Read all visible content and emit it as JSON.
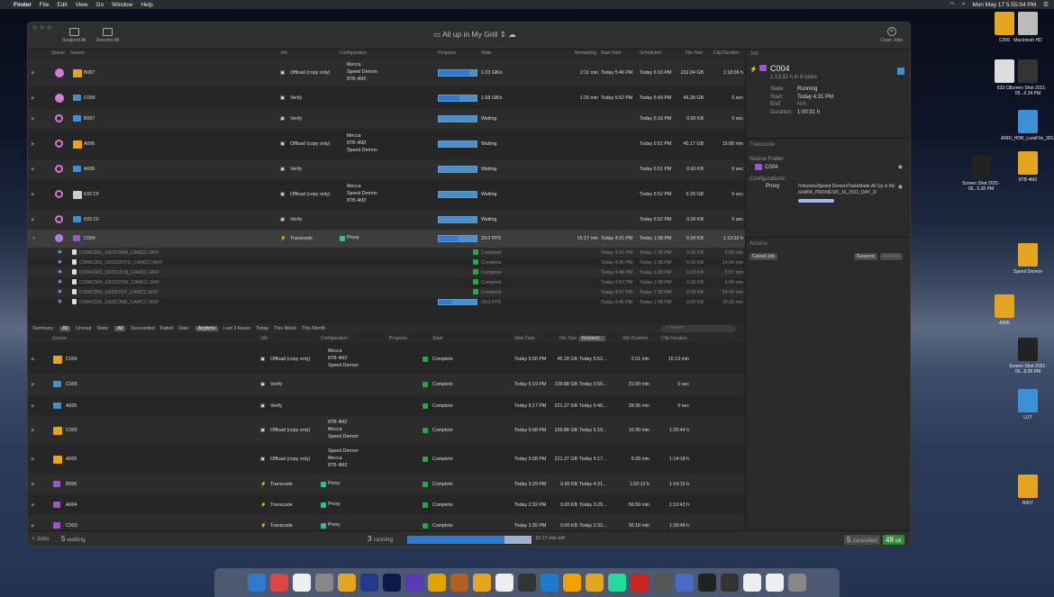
{
  "menubar": {
    "apple": "",
    "app": "Finder",
    "items": [
      "File",
      "Edit",
      "View",
      "Go",
      "Window",
      "Help"
    ],
    "clock": "Mon May 17  5:55:54 PM"
  },
  "window": {
    "title": "All up in My Grill ⇕",
    "suspend_all": "Suspend All",
    "resume_all": "Resume All",
    "close_jobs": "Close Jobs"
  },
  "queue_headers": {
    "queue": "Queue",
    "source": "Source",
    "job": "Job",
    "configuration": "Configuration",
    "progress": "Progress",
    "state": "State",
    "remaining": "Remaining",
    "start_date": "Start Date",
    "scheduled": "Scheduled",
    "file_size": "File Size",
    "clip_duration": "Clip Duration"
  },
  "queue_rows": [
    {
      "source": "B007",
      "job": "Offload (copy only)",
      "config": [
        "Mecca",
        "Speed Demon",
        "8TB 4M2"
      ],
      "progress": 0.82,
      "state": "1.03 GB/s",
      "remaining": "2:11 min",
      "start": "Today 5:46 PM",
      "scheduled": "Today 5:16 PM",
      "size": "232.04 GB",
      "dur": "1:18:06 h"
    },
    {
      "source": "C006",
      "job": "Verify",
      "config": [],
      "progress": 0.55,
      "state": "1.68 GB/s",
      "remaining": "1:25 min",
      "start": "Today 5:52 PM",
      "scheduled": "Today 5:49 PM",
      "size": "45.28 GB",
      "dur": "0 sec"
    },
    {
      "source": "B007",
      "job": "Verify",
      "config": [],
      "progress": 0,
      "state": "Waiting",
      "remaining": "",
      "start": "",
      "scheduled": "Today 5:16 PM",
      "size": "0.00 KB",
      "dur": "0 sec"
    },
    {
      "source": "A006",
      "job": "Offload (copy only)",
      "config": [
        "Mecca",
        "8TB 4M2",
        "Speed Demon"
      ],
      "progress": 0,
      "state": "Waiting",
      "remaining": "",
      "start": "",
      "scheduled": "Today 5:51 PM",
      "size": "45.17 GB",
      "dur": "15:08 min"
    },
    {
      "source": "A006",
      "job": "Verify",
      "config": [],
      "progress": 0,
      "state": "Waiting",
      "remaining": "",
      "start": "",
      "scheduled": "Today 5:51 PM",
      "size": "0.00 KB",
      "dur": "0 sec"
    },
    {
      "source": "633 CF",
      "job": "Offload (copy only)",
      "config": [
        "Mecca",
        "Speed Demon",
        "8TB 4M2"
      ],
      "progress": 0,
      "state": "Waiting",
      "remaining": "",
      "start": "",
      "scheduled": "Today 5:52 PM",
      "size": "6.29 GB",
      "dur": "0 sec"
    },
    {
      "source": "633 CF",
      "job": "Verify",
      "config": [],
      "progress": 0,
      "state": "Waiting",
      "remaining": "",
      "start": "",
      "scheduled": "Today 5:52 PM",
      "size": "0.00 KB",
      "dur": "0 sec"
    },
    {
      "source": "C004",
      "job": "Transcode",
      "config": [
        "Proxy"
      ],
      "progress": 0.5,
      "state": "29.0 FPS",
      "remaining": "15:17 min",
      "start": "Today 4:31 PM",
      "scheduled": "Today 1:38 PM",
      "size": "0.00 KB",
      "dur": "1:13:32 h"
    }
  ],
  "sub_rows": [
    {
      "name": "C004C001_160313BM_CAMCC.MXF",
      "state": "Complete",
      "start": "Today 4:31 PM",
      "sched": "Today 1:38 PM",
      "size": "0.00 KB",
      "dur": "6:00 min"
    },
    {
      "name": "C004C002_160313OYO_CAMCC.MXF",
      "state": "Complete",
      "start": "Today 4:36 PM",
      "sched": "Today 1:38 PM",
      "size": "0.00 KB",
      "dur": "14:34 min"
    },
    {
      "name": "C004C003_160313CM_CAMCC.MXF",
      "state": "Complete",
      "start": "Today 4:48 PM",
      "sched": "Today 1:38 PM",
      "size": "0.00 KB",
      "dur": "5:57 min"
    },
    {
      "name": "C004C004_160313SW_CAMCC.MXF",
      "state": "Complete",
      "start": "Today 4:52 PM",
      "sched": "Today 1:38 PM",
      "size": "0.00 KB",
      "dur": "5:43 min"
    },
    {
      "name": "C004C005_160313SY_CAMCC.MXF",
      "state": "Complete",
      "start": "Today 4:57 PM",
      "sched": "Today 1:38 PM",
      "size": "0.00 KB",
      "dur": "24:43 min"
    },
    {
      "name": "C004C006_160313NR_CAMCC.MXF",
      "state": "29.0 FPS",
      "start": "Today 5:46 PM",
      "sched": "Today 1:38 PM",
      "size": "0.00 KB",
      "dur": "16:32 min"
    }
  ],
  "summary": {
    "label": "Summary:",
    "all": "All",
    "unread": "Unread",
    "state_label": "State:",
    "state_all": "All",
    "succeeded": "Succeeded",
    "failed": "Failed",
    "date_label": "Date:",
    "anytime": "Anytime",
    "last2": "Last 2 Hours",
    "today": "Today",
    "week": "This Week",
    "month": "This Month",
    "search_placeholder": "Search"
  },
  "history_headers": {
    "source": "Source",
    "job": "Job",
    "configuration": "Configuration",
    "progress": "Progress",
    "state": "State",
    "start_date": "Start Date",
    "file_size": "File Size",
    "finished": "Finished...",
    "job_duration": "Job Duration",
    "clip_duration": "Clip Duration"
  },
  "history_rows": [
    {
      "source": "C006",
      "job": "Offload (copy only)",
      "config": [
        "Mecca",
        "8TB 4M2",
        "Speed Demon"
      ],
      "state": "Complete",
      "start": "Today 5:50 PM",
      "size": "45.28 GB",
      "fin": "Today 5:52...",
      "jdur": "2:01 min",
      "cdur": "15:13 min"
    },
    {
      "source": "C005",
      "job": "Verify",
      "config": [],
      "state": "Complete",
      "start": "Today 5:19 PM",
      "size": "239.88 GB",
      "fin": "Today 5:50...",
      "jdur": "31:00 min",
      "cdur": "0 sec"
    },
    {
      "source": "A005",
      "job": "Verify",
      "config": [],
      "state": "Complete",
      "start": "Today 5:17 PM",
      "size": "221.37 GB",
      "fin": "Today 5:46...",
      "jdur": "28:36 min",
      "cdur": "0 sec"
    },
    {
      "source": "C005",
      "job": "Offload (copy only)",
      "config": [
        "8TB 4M2",
        "Mecca",
        "Speed Demon"
      ],
      "state": "Complete",
      "start": "Today 5:08 PM",
      "size": "239.88 GB",
      "fin": "Today 5:19...",
      "jdur": "10:30 min",
      "cdur": "1:20:44 h"
    },
    {
      "source": "A005",
      "job": "Offload (copy only)",
      "config": [
        "Speed Demon",
        "Mecca",
        "8TB 4M2"
      ],
      "state": "Complete",
      "start": "Today 5:08 PM",
      "size": "221.37 GB",
      "fin": "Today 5:17...",
      "jdur": "9:28 min",
      "cdur": "1:14:18 h"
    },
    {
      "source": "B006",
      "job": "Transcode",
      "config": [
        "Proxy"
      ],
      "state": "Complete",
      "start": "Today 3:29 PM",
      "size": "0.00 KB",
      "fin": "Today 4:31...",
      "jdur": "1:02:12 h",
      "cdur": "1:14:15 h"
    },
    {
      "source": "A004",
      "job": "Transcode",
      "config": [
        "Proxy"
      ],
      "state": "Complete",
      "start": "Today 2:32 PM",
      "size": "0.00 KB",
      "fin": "Today 3:29...",
      "jdur": "56:59 min",
      "cdur": "1:13:42 h"
    },
    {
      "source": "C003",
      "job": "Transcode",
      "config": [
        "Proxy"
      ],
      "state": "Complete",
      "start": "Today 1:35 PM",
      "size": "0.00 KB",
      "fin": "Today 2:32...",
      "jdur": "56:18 min",
      "cdur": "1:18:48 h"
    }
  ],
  "side": {
    "job_header": "Job",
    "name": "C004",
    "sub": "1:13:32 h in 6 tasks",
    "state_label": "State:",
    "state": "Running",
    "start_label": "Start:",
    "start": "Today 4:31 PM",
    "end_label": "End:",
    "end": "N/A",
    "duration_label": "Duration:",
    "duration": "1:00:31 h",
    "transcode_header": "Transcode",
    "source_folder_label": "Source Folder:",
    "source_folder": "C004",
    "configurations_label": "Configurations:",
    "config_name": "Proxy",
    "config_path": "/Volumes/Speed Demon/TasteMade All Up in My Grill/04_PROXIES/5_16_2021_DAY_2/",
    "actions_header": "Actions",
    "cancel_job": "Cancel Job",
    "suspend": "Suspend",
    "resume": "Resume"
  },
  "status": {
    "jobs": "+ Jobs",
    "waiting_count": "5",
    "waiting": "waiting",
    "running_count": "3",
    "running": "running",
    "progress": 0.78,
    "left": "15:17 min left",
    "cancelled_count": "5",
    "cancelled": "cancelled",
    "ok_count": "48",
    "ok": "ok"
  },
  "desktop_icons": [
    "C006",
    "Macintosh HD",
    "633 CF",
    "Screen Shot 2021-05...6.34 PM",
    "ARRI_HDR_LookFile_3DLUTs_190319",
    "Screen Shot 2021-05...5.30 PM",
    "8TB 4M2",
    "Speed Demon",
    "A006",
    "Screen Shot 2021-05...9.05 PM",
    "LUT",
    "B007"
  ]
}
